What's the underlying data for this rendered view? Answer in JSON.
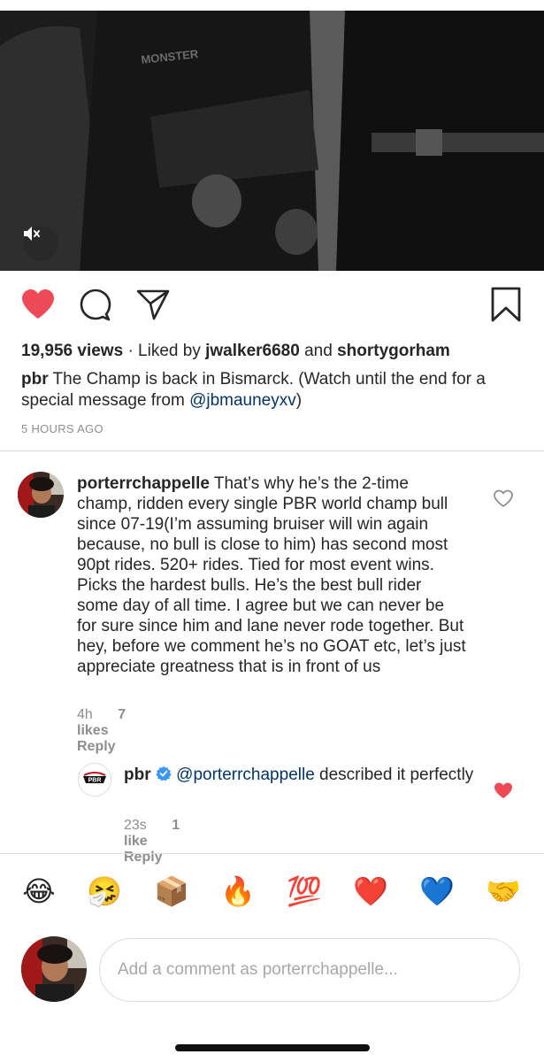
{
  "post": {
    "views": "19,956 views",
    "liked_by_prefix": "Liked by",
    "liked_user_1": "jwalker6680",
    "liked_and": "and",
    "liked_user_2": "shortygorham",
    "caption_user": "pbr",
    "caption_text": "The Champ is back in Bismarck. (Watch until the end for a special message from",
    "caption_mention": "@jbmauneyxv",
    "caption_end": ")",
    "time_ago": "5 HOURS AGO"
  },
  "comments": [
    {
      "username": "porterrchappelle",
      "text": "That’s why he’s the 2-time champ, ridden every single PBR world champ bull since 07-19(I’m assuming bruiser will win again because, no bull is close to him) has second most 90pt rides. 520+ rides. Tied for most event wins. Picks the hardest bulls. He’s the best bull rider some day of all time. I agree but we can never be for sure since him and lane never rode together. But hey, before we comment he’s no GOAT etc, let’s just appreciate greatness that is in front of us",
      "time": "4h",
      "likes": "7 likes",
      "reply": "Reply",
      "liked": false
    },
    {
      "username": "pbr",
      "verified": true,
      "mention": "@porterrchappelle",
      "text": "described it perfectly",
      "time": "23s",
      "likes": "1 like",
      "reply": "Reply",
      "liked": true
    }
  ],
  "emojis": [
    "😂",
    "🤧",
    "📦",
    "🔥",
    "💯",
    "❤️",
    "💙",
    "🤝"
  ],
  "composer": {
    "placeholder": "Add a comment as porterrchappelle..."
  },
  "colors": {
    "like_red": "#ed4956",
    "link_blue": "#003569",
    "verified_blue": "#3897f0",
    "muted_gray": "#8e8e8e"
  },
  "icons": [
    "heart-icon",
    "comment-icon",
    "share-icon",
    "bookmark-icon",
    "mute-icon",
    "verified-icon"
  ]
}
